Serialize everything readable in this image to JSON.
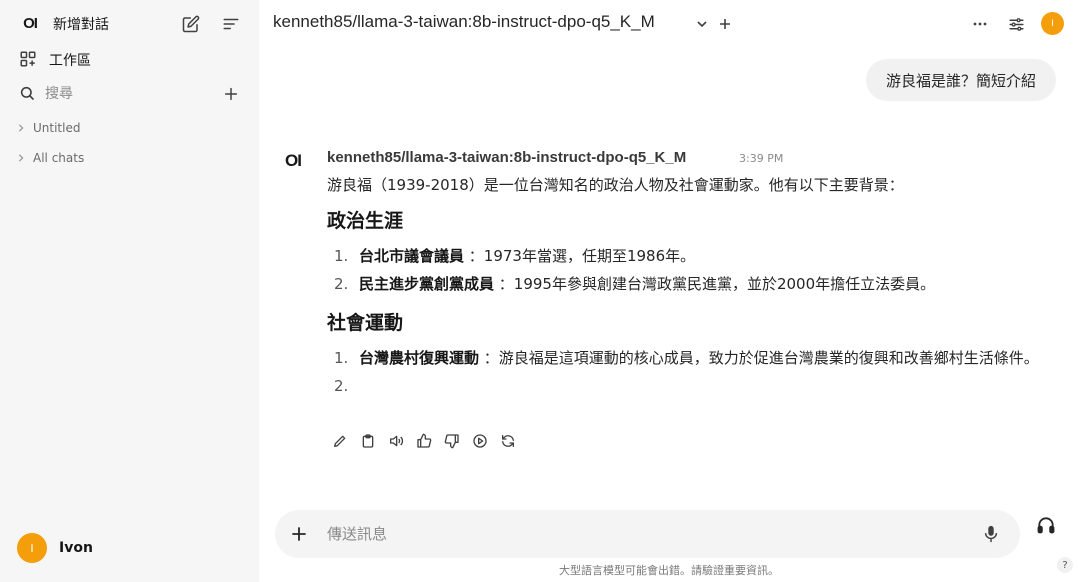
{
  "sidebar": {
    "logo": "OI",
    "new_chat_label": "新增對話",
    "workspace_label": "工作區",
    "search_placeholder": "搜尋",
    "folders": [
      {
        "label": "Untitled"
      },
      {
        "label": "All chats"
      }
    ],
    "user": {
      "initial": "I",
      "name": "Ivon"
    }
  },
  "header": {
    "model_name": "kenneth85/llama-3-taiwan:8b-instruct-dpo-q5_K_M",
    "avatar_initial": "I"
  },
  "conversation": {
    "user_message": "游良福是誰？簡短介紹",
    "assistant": {
      "logo": "OI",
      "model_name": "kenneth85/llama-3-taiwan:8b-instruct-dpo-q5_K_M",
      "time": "3:39 PM",
      "intro": "游良福（1939-2018）是一位台灣知名的政治人物及社會運動家。他有以下主要背景：",
      "sections": [
        {
          "heading": "政治生涯",
          "items": [
            {
              "num": "1.",
              "bold": "台北市議會議員",
              "text": " ：1973年當選，任期至1986年。"
            },
            {
              "num": "2.",
              "bold": "民主進步黨創黨成員",
              "text": " ：1995年參與創建台灣政黨民進黨，並於2000年擔任立法委員。"
            }
          ]
        },
        {
          "heading": "社會運動",
          "items": [
            {
              "num": "1.",
              "bold": "台灣農村復興運動",
              "text": " ：游良福是這項運動的核心成員，致力於促進台灣農業的復興和改善鄉村生活條件。"
            },
            {
              "num": "2.",
              "bold": "",
              "text": ""
            }
          ]
        }
      ],
      "actions": [
        "edit-icon",
        "copy-icon",
        "speaker-icon",
        "thumbs-up-icon",
        "thumbs-down-icon",
        "play-icon",
        "regenerate-icon"
      ]
    }
  },
  "composer": {
    "placeholder": "傳送訊息"
  },
  "footer": {
    "disclaimer": "大型語言模型可能會出錯。請驗證重要資訊。",
    "help": "?"
  }
}
